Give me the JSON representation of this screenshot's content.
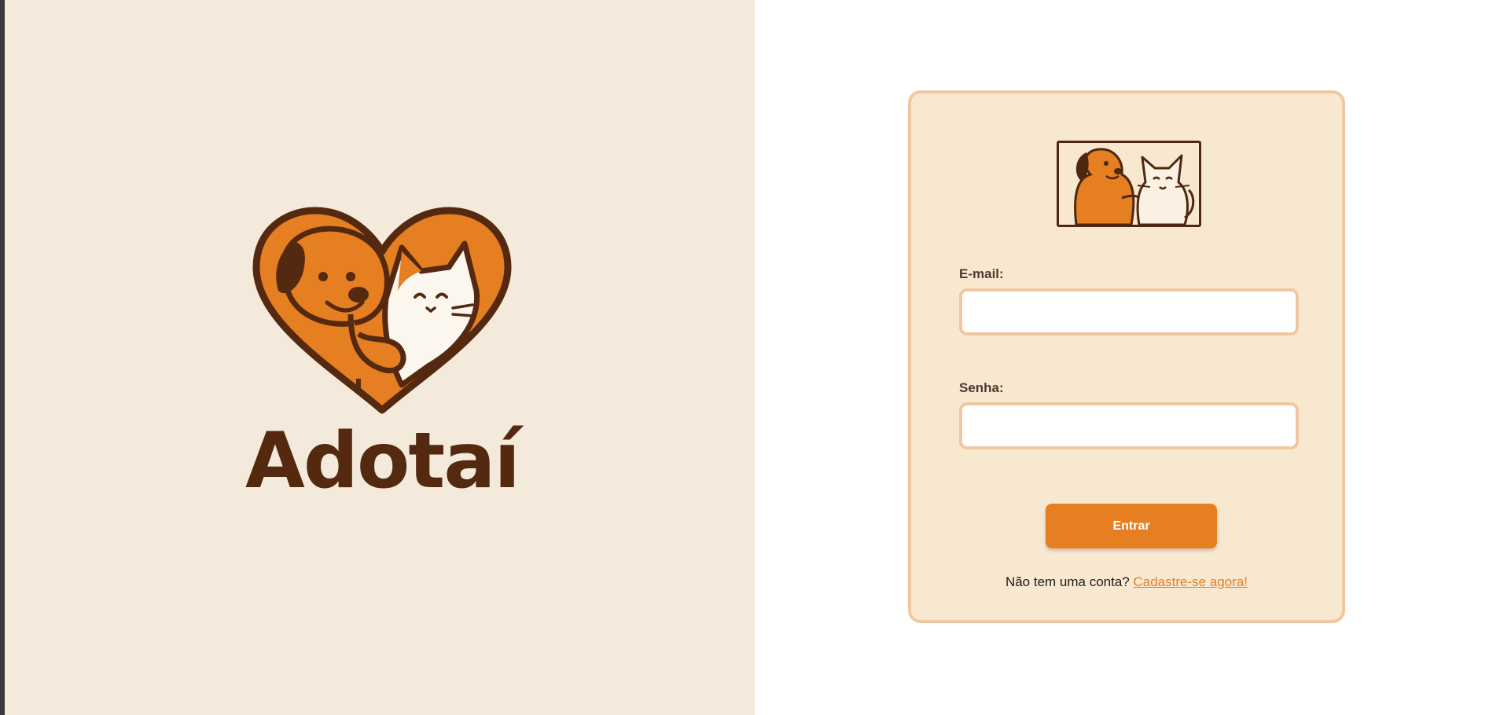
{
  "brand": {
    "name": "Adotaí",
    "colors": {
      "primary": "#e57f22",
      "dark_brown": "#55290f",
      "cream": "#f4eadb",
      "card_bg": "#f9e8d0",
      "card_border": "#efc7a3"
    }
  },
  "left_panel": {
    "logo_icon": "heart-dog-cat-icon"
  },
  "login_form": {
    "logo_icon": "dog-cat-framed-icon",
    "email_label": "E-mail:",
    "email_value": "",
    "password_label": "Senha:",
    "password_value": "",
    "submit_label": "Entrar",
    "signup_prompt": "Não tem uma conta?",
    "signup_link": "Cadastre-se agora!"
  }
}
